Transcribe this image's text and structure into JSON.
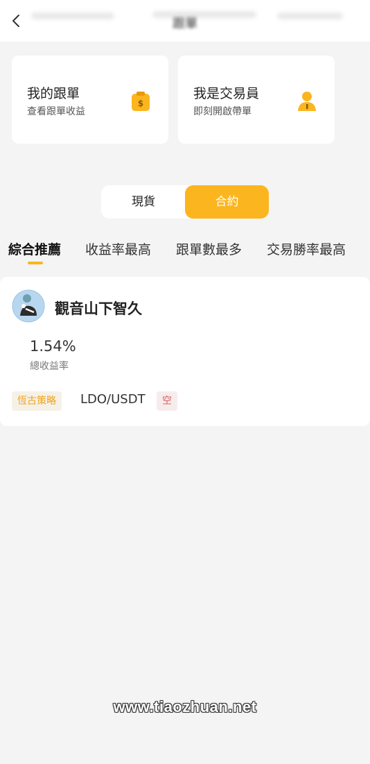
{
  "header": {
    "title": "跟單"
  },
  "cards": [
    {
      "title": "我的跟單",
      "subtitle": "查看跟單收益",
      "icon": "money-bag-icon",
      "icon_color": "#fbb51f"
    },
    {
      "title": "我是交易員",
      "subtitle": "即刻開啟帶單",
      "icon": "user-icon",
      "icon_color": "#fbb51f"
    }
  ],
  "market_toggle": {
    "options": [
      "現貨",
      "合約"
    ],
    "selected": "合約",
    "accent": "#fbb51f"
  },
  "tabs": [
    {
      "label": "綜合推薦",
      "active": true
    },
    {
      "label": "收益率最高",
      "active": false
    },
    {
      "label": "跟單數最多",
      "active": false
    },
    {
      "label": "交易勝率最高",
      "active": false
    }
  ],
  "traders": [
    {
      "name": "觀音山下智久",
      "pnl": "1.54%",
      "pnl_label": "總收益率",
      "strategy_tag": "恆古策略",
      "pair": "LDO/USDT",
      "direction": "空"
    }
  ],
  "watermark": "www.tiaozhuan.net"
}
